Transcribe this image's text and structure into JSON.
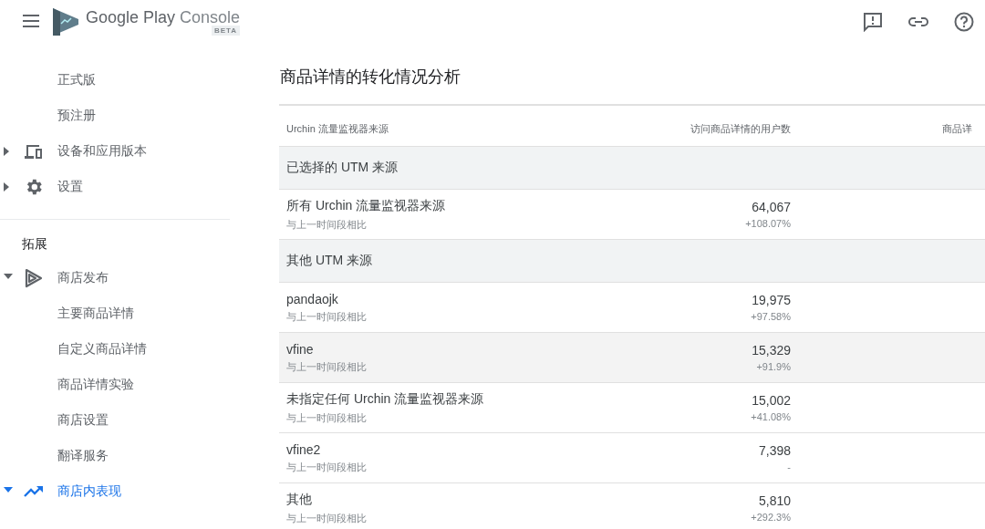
{
  "header": {
    "brand": "Google Play",
    "product": "Console",
    "badge": "BETA"
  },
  "sidebar": {
    "groups": [
      {
        "items": [
          {
            "label": "正式版",
            "kind": "leaf",
            "selected": false
          },
          {
            "label": "预注册",
            "kind": "leaf",
            "selected": false
          },
          {
            "label": "设备和应用版本",
            "kind": "parent",
            "expanded": false,
            "selected": false
          },
          {
            "label": "设置",
            "kind": "parent",
            "expanded": false,
            "selected": false
          }
        ]
      },
      {
        "title": "拓展",
        "items": [
          {
            "label": "商店发布",
            "kind": "parent",
            "expanded": true,
            "selected": false
          },
          {
            "label": "主要商品详情",
            "kind": "leaf",
            "selected": false
          },
          {
            "label": "自定义商品详情",
            "kind": "leaf",
            "selected": false
          },
          {
            "label": "商品详情实验",
            "kind": "leaf",
            "selected": false
          },
          {
            "label": "商店设置",
            "kind": "leaf",
            "selected": false
          },
          {
            "label": "翻译服务",
            "kind": "leaf",
            "selected": false
          },
          {
            "label": "商店内表现",
            "kind": "parent",
            "expanded": true,
            "selected": true
          }
        ]
      }
    ]
  },
  "main": {
    "title": "商品详情的转化情况分析",
    "table": {
      "columns": [
        "Urchin 流量监视器来源",
        "访问商品详情的用户数",
        "商品详"
      ],
      "rows": [
        {
          "kind": "section",
          "label": "已选择的 UTM 来源"
        },
        {
          "kind": "data",
          "name": "所有 Urchin 流量监视器来源",
          "note": "与上一时间段相比",
          "value": "64,067",
          "change": "+108.07%",
          "selected": false
        },
        {
          "kind": "section",
          "label": "其他 UTM 来源"
        },
        {
          "kind": "data",
          "name": "pandaojk",
          "note": "与上一时间段相比",
          "value": "19,975",
          "change": "+97.58%",
          "selected": false
        },
        {
          "kind": "data",
          "name": "vfine",
          "note": "与上一时间段相比",
          "value": "15,329",
          "change": "+91.9%",
          "selected": true
        },
        {
          "kind": "data",
          "name": "未指定任何 Urchin 流量监视器来源",
          "note": "与上一时间段相比",
          "value": "15,002",
          "change": "+41.08%",
          "selected": false
        },
        {
          "kind": "data",
          "name": "vfine2",
          "note": "与上一时间段相比",
          "value": "7,398",
          "change": "-",
          "selected": false
        },
        {
          "kind": "data",
          "name": "其他",
          "note": "与上一时间段相比",
          "value": "5,810",
          "change": "+292.3%",
          "selected": false
        }
      ]
    }
  }
}
